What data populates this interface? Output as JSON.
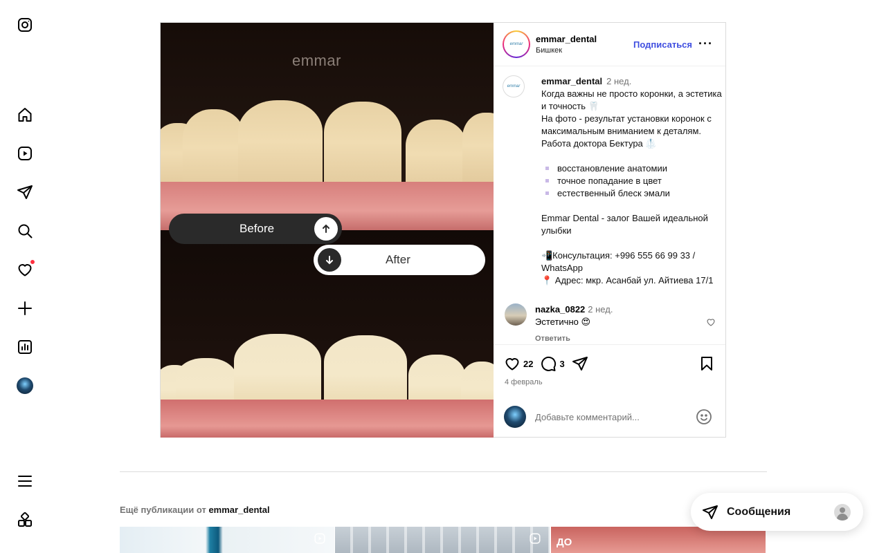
{
  "nav": {
    "items": [
      "instagram-logo",
      "home",
      "reels",
      "direct",
      "search",
      "notifications",
      "create",
      "dashboard",
      "profile",
      "menu",
      "also-from-meta"
    ]
  },
  "post": {
    "image": {
      "brand": "emmar",
      "before_label": "Before",
      "after_label": "After"
    },
    "header": {
      "username": "emmar_dental",
      "location": "Бишкек",
      "follow_label": "Подписаться",
      "more_label": "···"
    },
    "caption": {
      "username": "emmar_dental",
      "time": "2 нед.",
      "lines": [
        "Когда важны не просто коронки, а эстетика и точность 🦷",
        "На фото - результат установки коронок с максимальным вниманием к деталям.",
        "Работа доктора Бектура 🥼",
        "",
        "восстановление анатомии",
        "точное попадание в цвет",
        "естественный блеск эмали",
        "",
        "Emmar Dental - залог Вашей идеальной улыбки",
        "",
        "📲Консультация: +996 555 66 99 33 / WhatsApp",
        "📍 Адрес: мкр. Асанбай ул. Айтиева 17/1"
      ]
    },
    "comment": {
      "username": "nazka_0822",
      "time": "2 нед.",
      "text": "Эстетично 😍",
      "reply_label": "Ответить"
    },
    "actions": {
      "likes": "22",
      "comments": "3"
    },
    "date": "4 февраль",
    "add_comment_placeholder": "Добавьте комментарий..."
  },
  "more_posts": {
    "prefix": "Ещё публикации от",
    "username": "emmar_dental",
    "thumb3_label": "ДО"
  },
  "messages": {
    "label": "Сообщения"
  }
}
